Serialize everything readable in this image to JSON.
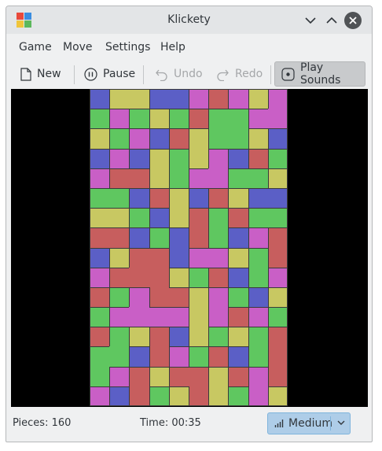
{
  "window": {
    "title": "Klickety"
  },
  "menu": {
    "game": "Game",
    "move": "Move",
    "settings": "Settings",
    "help": "Help"
  },
  "toolbar": {
    "new": "New",
    "pause": "Pause",
    "undo": "Undo",
    "redo": "Redo",
    "sounds": "Play Sounds"
  },
  "status": {
    "pieces": "Pieces: 160",
    "time": "Time: 00:35",
    "difficulty": "Medium"
  },
  "board": {
    "columns": 10,
    "rows": 16,
    "palette": {
      "B": "#5b5fc6",
      "Y": "#c8c862",
      "M": "#c95fc6",
      "R": "#c75e5e",
      "G": "#5fc760"
    },
    "grid": [
      "BYYBBMRMYM",
      "GMGYGRGGMM",
      "YGMBRYGGYB",
      "BMBYGYMBRG",
      "MRRYGMMGGY",
      "GGBRYBRYBB",
      "YYGBYRGRGG",
      "RRBGBRGBMR",
      "BYRRBMMYGR",
      "MRRRYGRBGM",
      "RGMRRYMGBY",
      "GMMMMYMRMG",
      "RGYRBYGYGR",
      "GGBRMGRBGR",
      "GMRYRRYRMR",
      "MBRGYRYGMY"
    ]
  },
  "colors": {
    "accent": "#aecde8",
    "titlebar": "#e3e5e7",
    "window_bg": "#eff0f1",
    "board_bg": "#000000"
  }
}
